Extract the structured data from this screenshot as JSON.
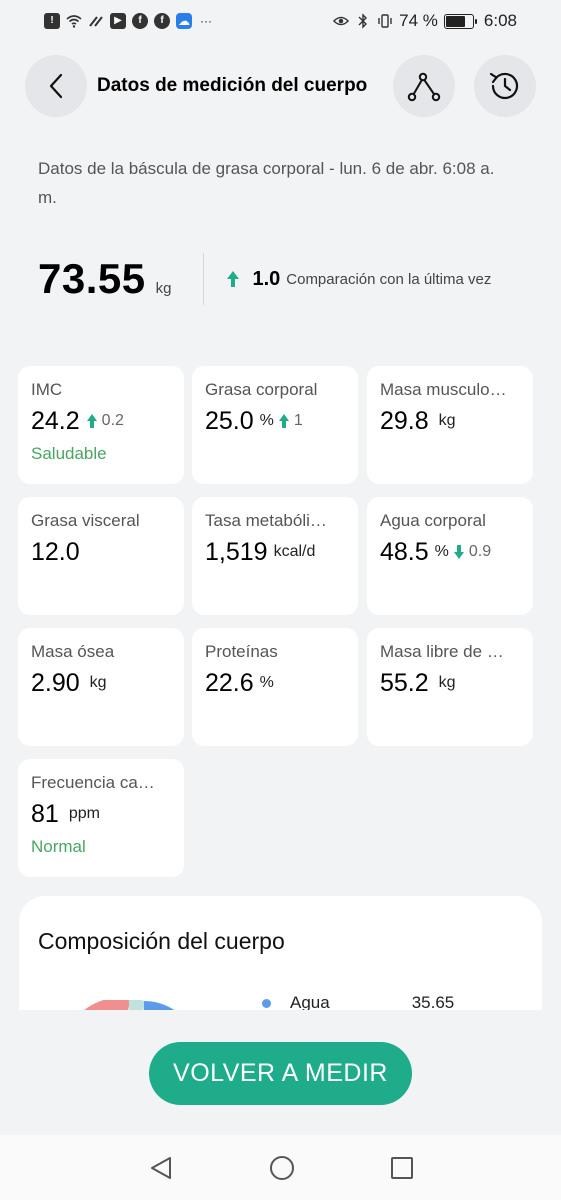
{
  "status_bar": {
    "battery_text": "74 %",
    "battery_level": 0.74,
    "time": "6:08",
    "icons_left": [
      "alert-icon",
      "wifi-icon",
      "link-icon",
      "youtube-icon",
      "facebook-icon",
      "facebook-icon",
      "cloud-icon",
      "more-icon"
    ],
    "icons_right": [
      "eye-icon",
      "bluetooth-icon",
      "vibrate-icon",
      "battery-icon"
    ]
  },
  "header": {
    "title": "Datos de medición del cuerpo",
    "back_icon": "chevron-left-icon",
    "share_icon": "trend-icon",
    "history_icon": "history-icon"
  },
  "source": {
    "text": "Datos de la báscula de grasa corporal - lun. 6 de abr. 6:08 a. m."
  },
  "weight": {
    "value": "73.55",
    "unit": "kg",
    "change": "1.0",
    "change_direction": "up",
    "change_label": "Comparación con la última vez"
  },
  "metrics": [
    {
      "label": "IMC",
      "value": "24.2",
      "unit": "",
      "delta": "0.2",
      "delta_dir": "up",
      "status": "Saludable"
    },
    {
      "label": "Grasa corporal",
      "value": "25.0",
      "unit": "%",
      "delta": "1",
      "delta_dir": "up",
      "status": ""
    },
    {
      "label": "Masa musculo…",
      "value": "29.8",
      "unit": "kg",
      "delta": "",
      "delta_dir": "",
      "status": ""
    },
    {
      "label": "Grasa visceral",
      "value": "12.0",
      "unit": "",
      "delta": "",
      "delta_dir": "",
      "status": ""
    },
    {
      "label": "Tasa metabóli…",
      "value": "1,519",
      "unit": "kcal/d",
      "delta": "",
      "delta_dir": "",
      "status": ""
    },
    {
      "label": "Agua corporal",
      "value": "48.5",
      "unit": "%",
      "delta": "0.9",
      "delta_dir": "down",
      "status": ""
    },
    {
      "label": "Masa ósea",
      "value": "2.90",
      "unit": "kg",
      "delta": "",
      "delta_dir": "",
      "status": ""
    },
    {
      "label": "Proteínas",
      "value": "22.6",
      "unit": "%",
      "delta": "",
      "delta_dir": "",
      "status": ""
    },
    {
      "label": "Masa libre de …",
      "value": "55.2",
      "unit": "kg",
      "delta": "",
      "delta_dir": "",
      "status": ""
    },
    {
      "label": "Frecuencia ca…",
      "value": "81",
      "unit": "ppm",
      "delta": "",
      "delta_dir": "",
      "status": "Normal"
    }
  ],
  "composition": {
    "title": "Composición del cuerpo",
    "legend": [
      {
        "label": "Agua",
        "value": "35.65"
      }
    ]
  },
  "colors": {
    "accent": "#1eac8a",
    "up_arrow": "#1eac8a",
    "healthy": "#4aa564",
    "legend_water": "#5b9bea"
  },
  "actions": {
    "measure_again": "VOLVER A MEDIR"
  },
  "nav": {
    "back_icon": "triangle-back-icon",
    "home_icon": "circle-home-icon",
    "recents_icon": "square-recents-icon"
  }
}
